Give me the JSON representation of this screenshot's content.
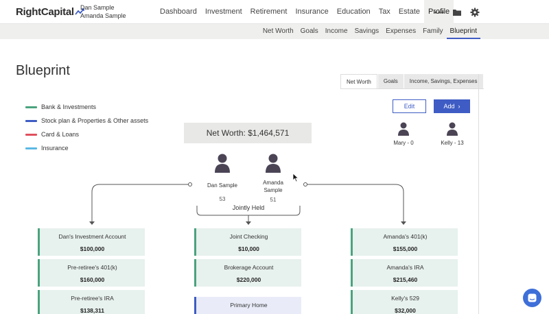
{
  "brand": {
    "name": "RightCapital"
  },
  "users": [
    "Dan Sample",
    "Amanda Sample"
  ],
  "main_nav": [
    {
      "label": "Dashboard",
      "active": false
    },
    {
      "label": "Investment",
      "active": false
    },
    {
      "label": "Retirement",
      "active": false
    },
    {
      "label": "Insurance",
      "active": false
    },
    {
      "label": "Education",
      "active": false
    },
    {
      "label": "Tax",
      "active": false
    },
    {
      "label": "Estate",
      "active": false
    },
    {
      "label": "Profile",
      "active": true
    }
  ],
  "top_icons": [
    "more-dots-icon",
    "folder-icon",
    "gear-icon"
  ],
  "sub_nav": [
    {
      "label": "Net Worth",
      "active": false
    },
    {
      "label": "Goals",
      "active": false
    },
    {
      "label": "Income",
      "active": false
    },
    {
      "label": "Savings",
      "active": false
    },
    {
      "label": "Expenses",
      "active": false
    },
    {
      "label": "Family",
      "active": false
    },
    {
      "label": "Blueprint",
      "active": true
    }
  ],
  "page_title": "Blueprint",
  "view_tabs": [
    {
      "label": "Net Worth",
      "active": true
    },
    {
      "label": "Goals",
      "active": false
    },
    {
      "label": "Income, Savings, Expenses",
      "active": false
    }
  ],
  "legend": [
    {
      "label": "Bank & Investments",
      "color": "#4aa37e"
    },
    {
      "label": "Stock plan & Properties & Other assets",
      "color": "#3e5cc4"
    },
    {
      "label": "Card & Loans",
      "color": "#e0505e"
    },
    {
      "label": "Insurance",
      "color": "#5bb8e4"
    }
  ],
  "net_worth": "Net Worth: $1,464,571",
  "buttons": {
    "edit": "Edit",
    "add": "Add"
  },
  "clients": [
    {
      "name": "Dan Sample",
      "age": "53"
    },
    {
      "name": "Amanda Sample",
      "age": "51"
    }
  ],
  "dependents": [
    {
      "name": "Mary - 0"
    },
    {
      "name": "Kelly - 13"
    }
  ],
  "jointly_held": "Jointly Held",
  "columns": [
    {
      "owner": "Dan",
      "accounts": [
        {
          "name": "Dan's Investment Account",
          "value": "$100,000",
          "type": "bank"
        },
        {
          "name": "Pre-retiree's 401(k)",
          "value": "$160,000",
          "type": "bank"
        },
        {
          "name": "Pre-retiree's IRA",
          "value": "$138,311",
          "type": "bank"
        }
      ]
    },
    {
      "owner": "Joint",
      "accounts": [
        {
          "name": "Joint Checking",
          "value": "$10,000",
          "type": "bank"
        },
        {
          "name": "Brokerage Account",
          "value": "$220,000",
          "type": "bank"
        },
        {
          "name": "Primary Home",
          "value": "",
          "type": "property"
        }
      ]
    },
    {
      "owner": "Amanda",
      "accounts": [
        {
          "name": "Amanda's 401(k)",
          "value": "$155,000",
          "type": "bank"
        },
        {
          "name": "Amanda's IRA",
          "value": "$215,460",
          "type": "bank"
        },
        {
          "name": "Kelly's 529",
          "value": "$32,000",
          "type": "bank"
        }
      ]
    }
  ]
}
